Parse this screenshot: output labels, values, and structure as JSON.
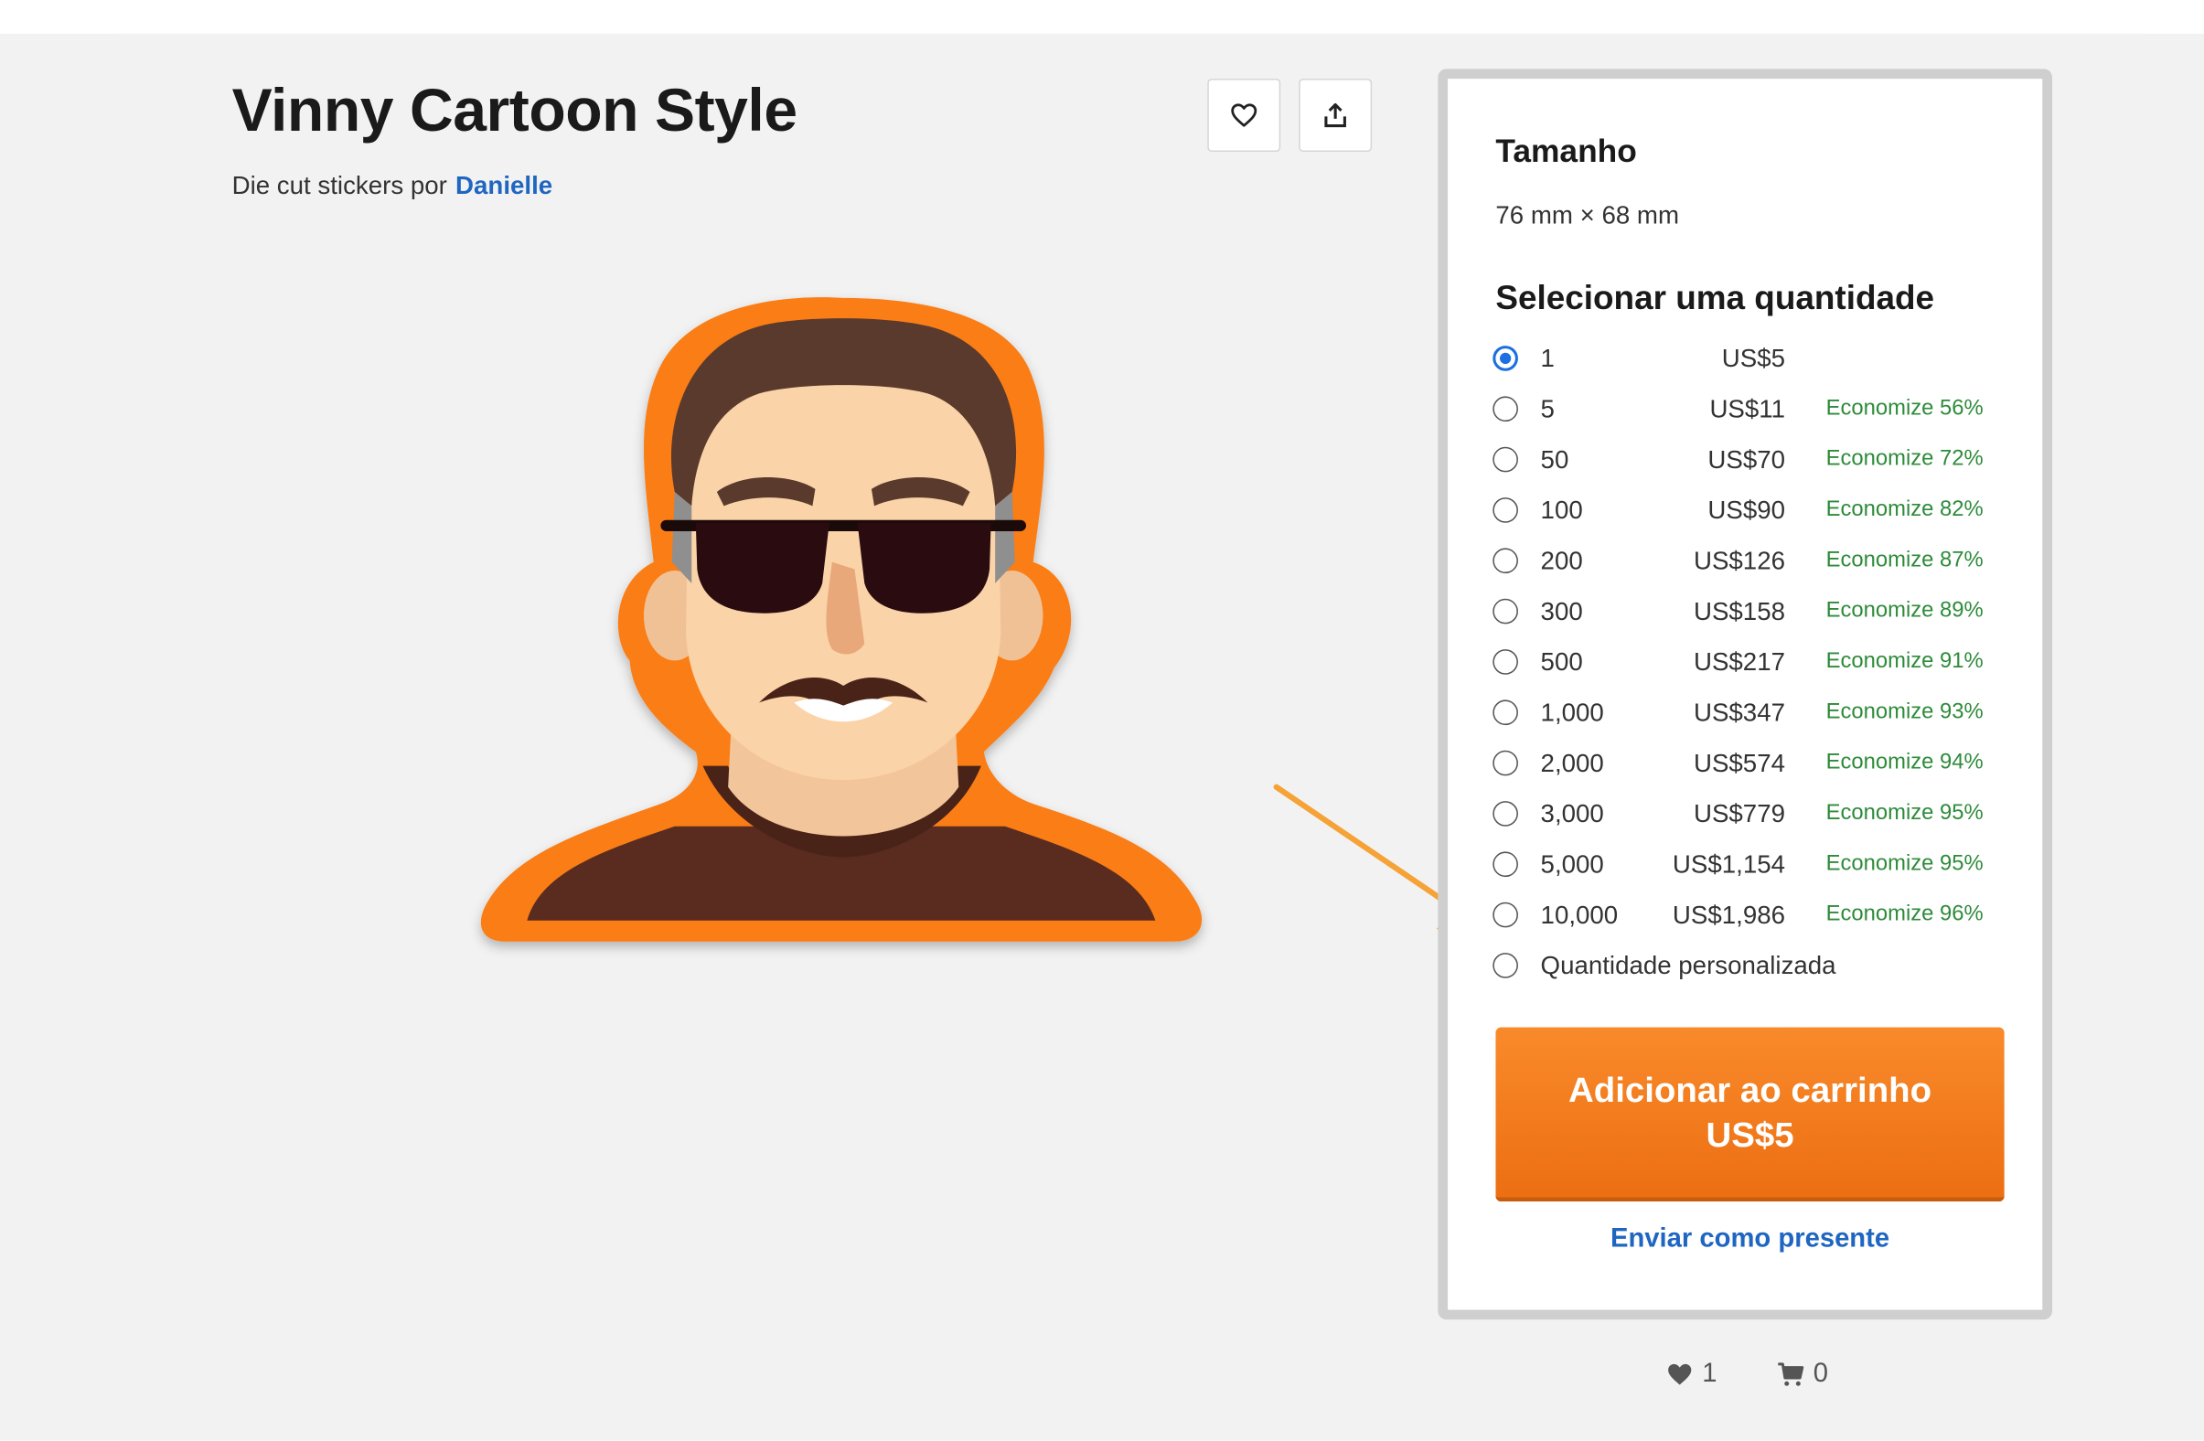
{
  "product": {
    "title": "Vinny Cartoon Style",
    "byline_prefix": "Die cut stickers por",
    "author": "Danielle"
  },
  "icons": {
    "favorite": "heart-outline-icon",
    "share": "share-upload-icon",
    "likes": "heart-icon",
    "cart": "cart-icon"
  },
  "panel": {
    "size_title": "Tamanho",
    "size_value": "76 mm × 68 mm",
    "quantity_title": "Selecionar uma quantidade",
    "options": [
      {
        "qty": "1",
        "price": "US$5",
        "save": "",
        "selected": true
      },
      {
        "qty": "5",
        "price": "US$11",
        "save": "Economize 56%"
      },
      {
        "qty": "50",
        "price": "US$70",
        "save": "Economize 72%"
      },
      {
        "qty": "100",
        "price": "US$90",
        "save": "Economize 82%"
      },
      {
        "qty": "200",
        "price": "US$126",
        "save": "Economize 87%"
      },
      {
        "qty": "300",
        "price": "US$158",
        "save": "Economize 89%"
      },
      {
        "qty": "500",
        "price": "US$217",
        "save": "Economize 91%"
      },
      {
        "qty": "1,000",
        "price": "US$347",
        "save": "Economize 93%"
      },
      {
        "qty": "2,000",
        "price": "US$574",
        "save": "Economize 94%"
      },
      {
        "qty": "3,000",
        "price": "US$779",
        "save": "Economize 95%"
      },
      {
        "qty": "5,000",
        "price": "US$1,154",
        "save": "Economize 95%"
      },
      {
        "qty": "10,000",
        "price": "US$1,986",
        "save": "Economize 96%"
      }
    ],
    "custom_quantity": "Quantidade personalizada",
    "add_to_cart_line1": "Adicionar ao carrinho",
    "add_to_cart_line2": "US$5",
    "gift_link": "Enviar como presente"
  },
  "stats": {
    "likes": "1",
    "in_cart": "0"
  },
  "colors": {
    "accent_orange": "#f07a1d",
    "link_blue": "#1f66c1",
    "save_green": "#2e8b3a",
    "radio_blue": "#1b6fe0"
  }
}
